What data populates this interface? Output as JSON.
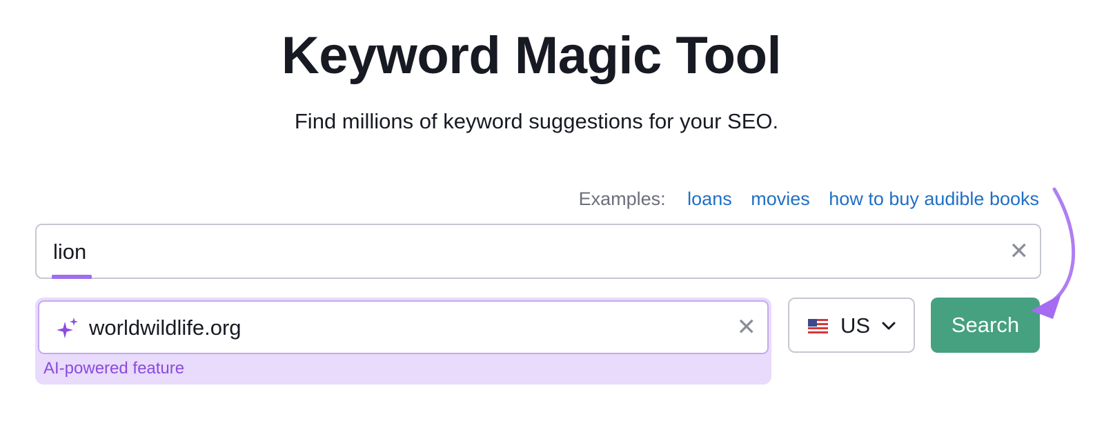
{
  "header": {
    "title": "Keyword Magic Tool",
    "subtitle": "Find millions of keyword suggestions for your SEO."
  },
  "examples": {
    "label": "Examples:",
    "links": [
      "loans",
      "movies",
      "how to buy audible books"
    ]
  },
  "keyword_input": {
    "value": "lion",
    "clear_icon": "close-icon"
  },
  "domain_input": {
    "value": "worldwildlife.org",
    "icon": "sparkle-icon",
    "clear_icon": "close-icon",
    "feature_label": "AI-powered feature"
  },
  "country_select": {
    "value": "US",
    "flag_icon": "us-flag-icon",
    "dropdown_icon": "chevron-down-icon"
  },
  "search_button": {
    "label": "Search"
  },
  "colors": {
    "accent_purple": "#a06cf0",
    "link_blue": "#1f6fc5",
    "search_green": "#45a180",
    "ai_panel_bg": "#e9dbfb"
  }
}
